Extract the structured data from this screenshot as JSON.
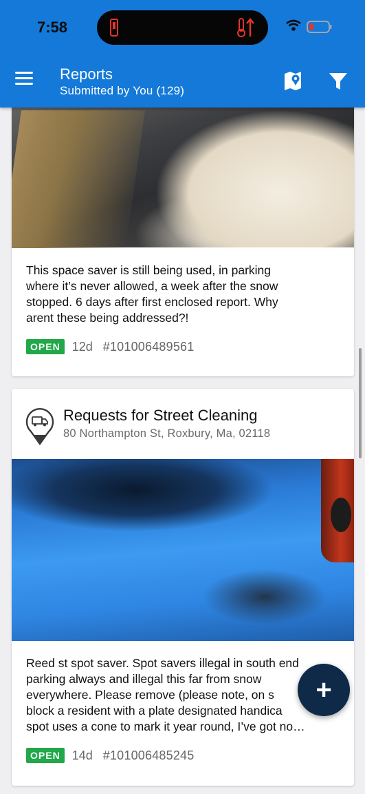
{
  "status_bar": {
    "time": "7:58"
  },
  "header": {
    "title": "Reports",
    "subtitle": "Submitted by You (129)",
    "menu_icon": "hamburger-menu-icon",
    "map_icon": "map-pin-icon",
    "filter_icon": "filter-icon",
    "background_color": "#1479d8"
  },
  "reports": [
    {
      "description_lines": [
        "This space saver is still being used, in parking",
        "where it’s never allowed, a week after the snow",
        "stopped. 6 days after first enclosed report. Why",
        "arent these being addressed?!"
      ],
      "status": "OPEN",
      "age": "12d",
      "ticket": "#101006489561"
    },
    {
      "title": "Requests for Street Cleaning",
      "address": "80 Northampton St, Roxbury, Ma, 02118",
      "icon": "street-cleaning-truck-pin-icon",
      "description_lines": [
        "Reed st spot saver. Spot savers illegal in south end",
        "parking always and illegal this far from snow",
        "everywhere. Please remove (please note, on s",
        "block a resident with a plate designated handica",
        "spot uses a cone to mark it year round, I’ve got no…"
      ],
      "status": "OPEN",
      "age": "14d",
      "ticket": "#101006485245"
    }
  ],
  "fab": {
    "label": "+",
    "icon": "add-report-icon"
  },
  "colors": {
    "open_badge": "#20a849",
    "fab": "#0e2a48"
  }
}
